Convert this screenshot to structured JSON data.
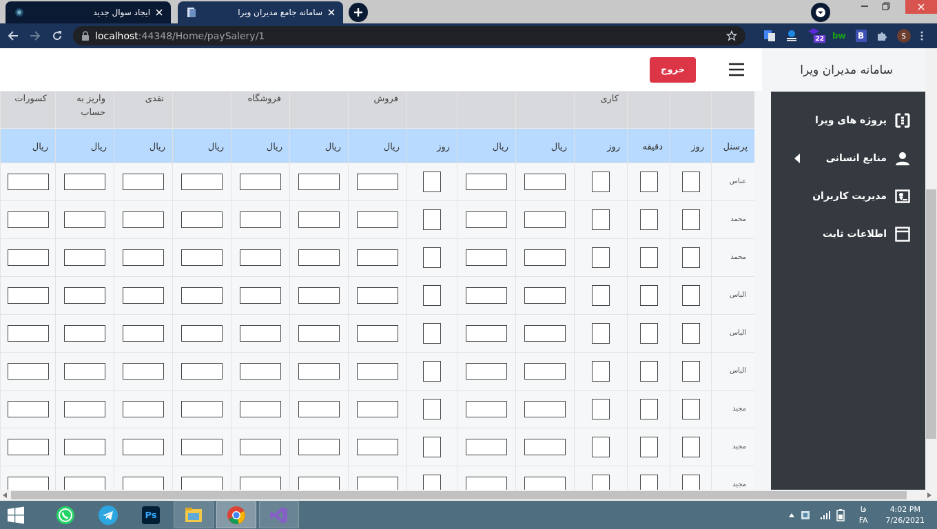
{
  "browser": {
    "tabs": [
      {
        "title": "سامانه جامع مدیران ویرا",
        "selected": true
      },
      {
        "title": "ایجاد سوال جدید",
        "selected": false
      }
    ],
    "address": {
      "host": "localhost",
      "rest": ":44348/Home/paySalery/1"
    },
    "extensions": [
      {
        "kind": "puzzle"
      },
      {
        "kind": "letter",
        "label": "B"
      },
      {
        "kind": "text",
        "label": "bw"
      },
      {
        "kind": "stack",
        "badge": "22"
      },
      {
        "kind": "scale"
      },
      {
        "kind": "translate"
      }
    ],
    "profile": "S"
  },
  "page": {
    "brand": "سامانه مدیران ویرا",
    "logout": "خروج",
    "sidebar": [
      {
        "label": "پروژه های ویرا",
        "has_submenu": false
      },
      {
        "label": "منابع انسانی",
        "has_submenu": true
      },
      {
        "label": "مدیریت کاربران",
        "has_submenu": false
      },
      {
        "label": "اطلاعات ثابت",
        "has_submenu": false
      }
    ],
    "table": {
      "columns": [
        {
          "unit": "پرسنل",
          "kind": "name"
        },
        {
          "unit": "روز",
          "kind": "small"
        },
        {
          "unit": "دقیقه",
          "kind": "small"
        },
        {
          "group": "کاری",
          "unit": "روز",
          "kind": "small"
        },
        {
          "unit": "ریال",
          "kind": "wide"
        },
        {
          "unit": "ریال",
          "kind": "wide"
        },
        {
          "unit": "روز",
          "kind": "small"
        },
        {
          "group": "فروش",
          "unit": "ریال",
          "kind": "wide"
        },
        {
          "unit": "ریال",
          "kind": "wide"
        },
        {
          "group": "فروشگاه",
          "unit": "ریال",
          "kind": "wide"
        },
        {
          "unit": "ریال",
          "kind": "wide"
        },
        {
          "group": "نقدی",
          "unit": "ریال",
          "kind": "wide"
        },
        {
          "group": "واریز به حساب",
          "unit": "ریال",
          "kind": "wide"
        },
        {
          "group": "کسورات",
          "unit": "ریال",
          "kind": "wide"
        }
      ],
      "rows": [
        {
          "name": "عباس"
        },
        {
          "name": "محمد"
        },
        {
          "name": "محمد"
        },
        {
          "name": "الیاس"
        },
        {
          "name": "الیاس"
        },
        {
          "name": "الیاس"
        },
        {
          "name": "مجید"
        },
        {
          "name": "مجید"
        },
        {
          "name": "مجید"
        }
      ]
    }
  },
  "taskbar": {
    "apps": [
      {
        "kind": "whatsapp",
        "selected": false
      },
      {
        "kind": "telegram",
        "selected": false
      },
      {
        "kind": "photoshop",
        "label": "Ps",
        "selected": false
      },
      {
        "kind": "explorer",
        "selected": false
      },
      {
        "kind": "chrome",
        "selected": true
      },
      {
        "kind": "vs",
        "selected": false
      }
    ],
    "ime": "فا",
    "lang": "FA",
    "time": "4:02 PM",
    "date": "7/26/2021"
  }
}
